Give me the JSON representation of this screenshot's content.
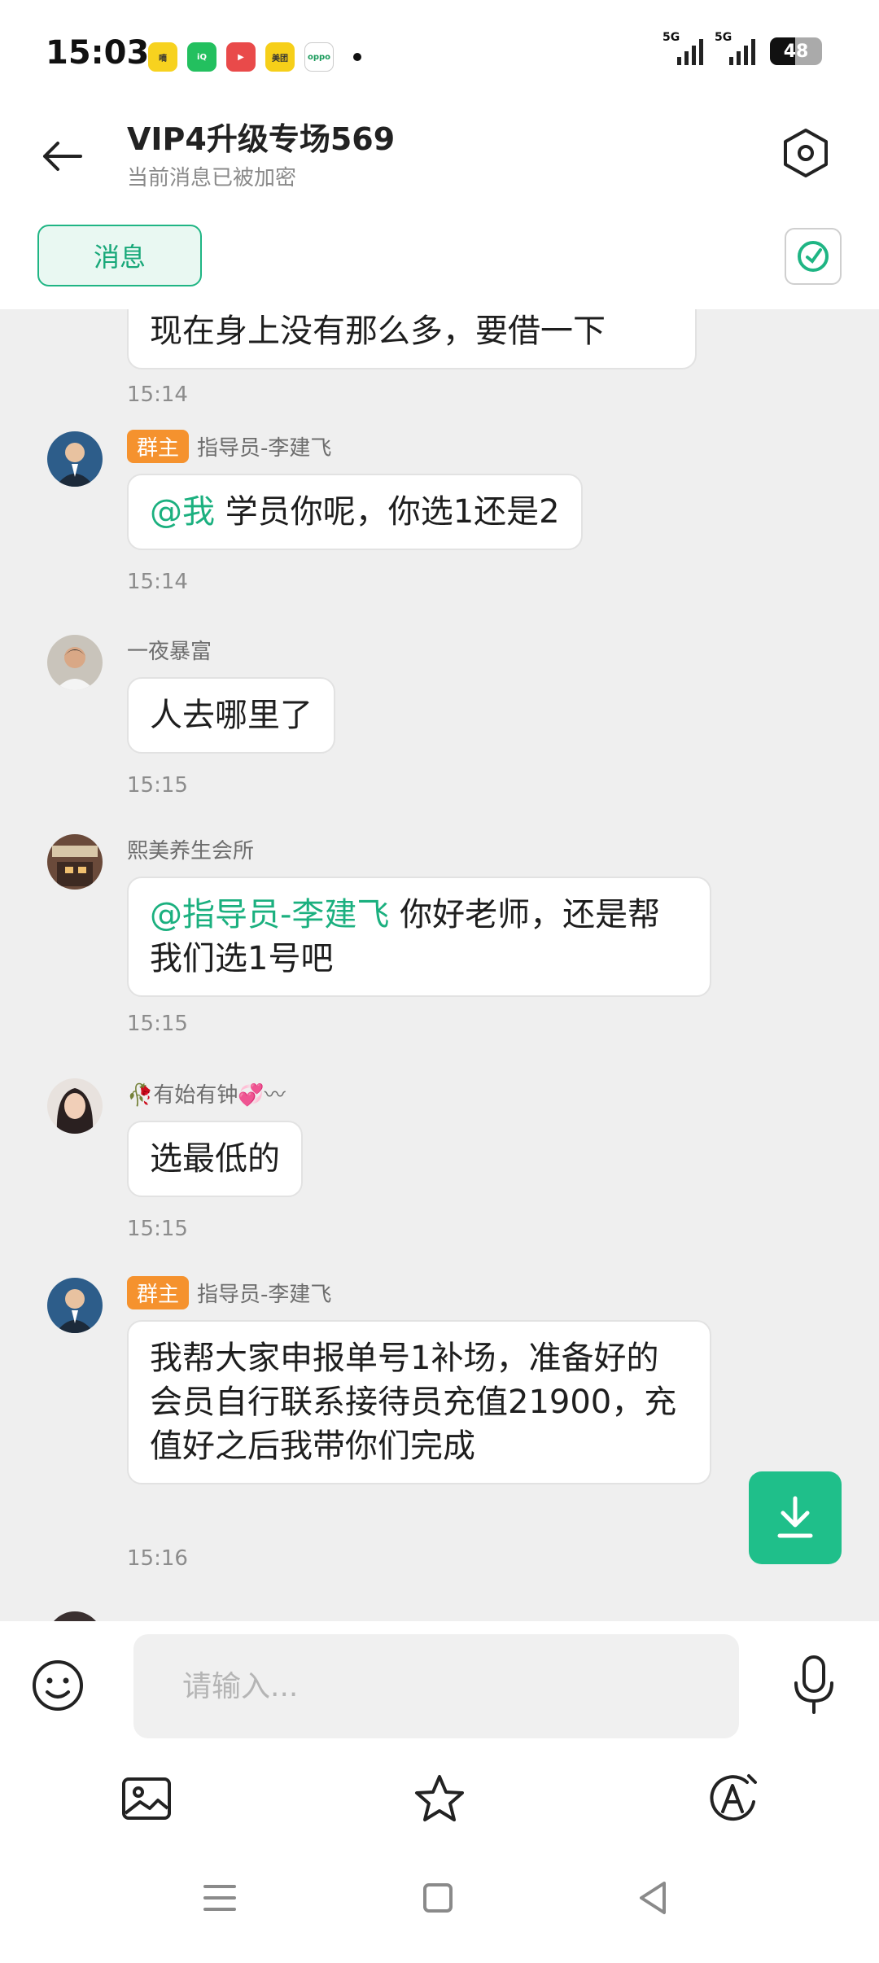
{
  "status_bar": {
    "time": "15:03",
    "apps": [
      {
        "name": "icon-1",
        "label": "嘀嗒",
        "color": "#f7d21f"
      },
      {
        "name": "icon-2",
        "label": "iQIYI",
        "color": "#23c05f"
      },
      {
        "name": "icon-3",
        "label": "▶",
        "color": "#e94a4a"
      },
      {
        "name": "icon-4",
        "label": "美团",
        "color": "#f6cf19"
      },
      {
        "name": "icon-5",
        "label": "oppo",
        "color": "#1b9b5c"
      }
    ],
    "signal_label_1": "5G",
    "signal_label_2": "5G",
    "battery_level": "48"
  },
  "header": {
    "title": "VIP4升级专场569",
    "subtitle": "当前消息已被加密"
  },
  "tabs": {
    "messages_label": "消息"
  },
  "messages": [
    {
      "type": "partial",
      "text": "现在身上没有那么多，要借一下",
      "time": "15:14"
    },
    {
      "sender": "指导员-李建飞",
      "badge": "群主",
      "mention": "@我",
      "text": " 学员你呢，你选1还是2",
      "time": "15:14"
    },
    {
      "sender": "一夜暴富",
      "text": "人去哪里了",
      "time": "15:15"
    },
    {
      "sender": "熙美养生会所",
      "mention": "@指导员-李建飞",
      "text": " 你好老师，还是帮我们选1号吧",
      "time": "15:15"
    },
    {
      "sender": "🥀有始有钟💞〰",
      "text": "选最低的",
      "time": "15:15"
    },
    {
      "sender": "指导员-李建飞",
      "badge": "群主",
      "text": "我帮大家申报单号1补场，准备好的会员自行联系接待员充值21900，充值好之后我带你们完成",
      "time": "15:16"
    }
  ],
  "input": {
    "placeholder": "请输入..."
  },
  "colors": {
    "accent": "#1fb584",
    "badge": "#f5922e",
    "chat_bg": "#efefef"
  }
}
